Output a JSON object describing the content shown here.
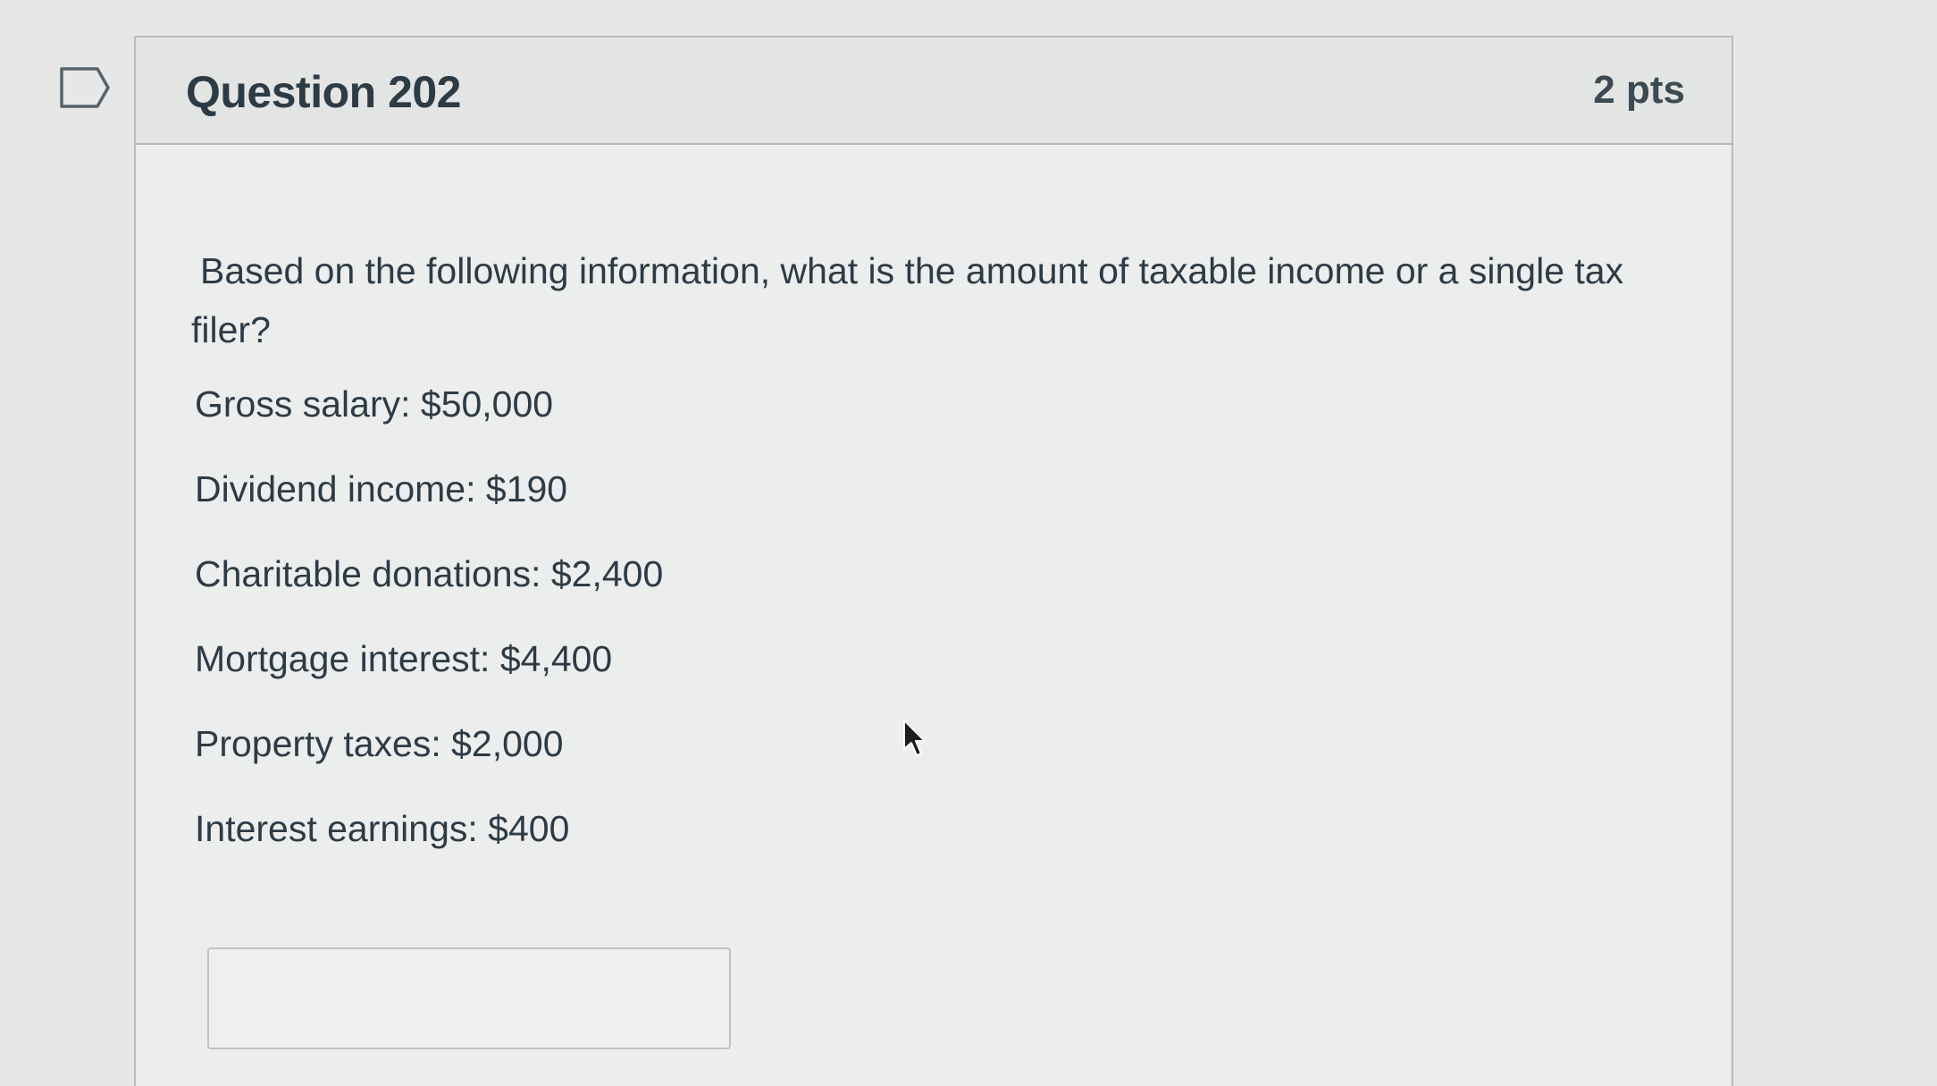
{
  "question": {
    "title": "Question 202",
    "points": "2 pts",
    "prompt": "Based on the following information, what is the amount of taxable income or a single tax filer?",
    "facts": [
      "Gross salary: $50,000",
      "Dividend income: $190",
      "Charitable donations: $2,400",
      "Mortgage interest: $4,400",
      "Property taxes: $2,000",
      "Interest earnings: $400"
    ],
    "answer_value": ""
  },
  "icons": {
    "flag": "flag-question-icon",
    "cursor": "mouse-pointer-icon"
  },
  "colors": {
    "text": "#2d3b45",
    "header_bg": "#e3e4e4",
    "border": "#b9bbbc"
  }
}
